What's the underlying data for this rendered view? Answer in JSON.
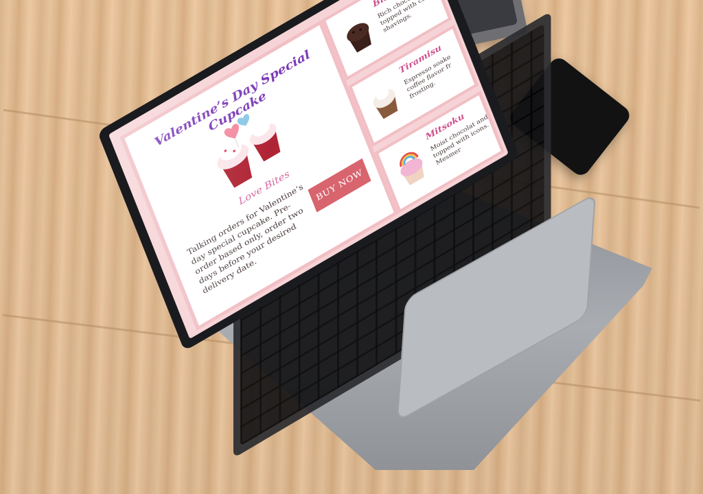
{
  "scene": {
    "objects": [
      "laptop",
      "smartphone",
      "tablet"
    ]
  },
  "screen": {
    "featured": {
      "title": "Valentine’s Day Special Cupcake",
      "subtitle": "Love Bites",
      "description": "Talking orders for Valentine’s day special cupcake. Pre-order based only, order two days before your desired delivery date.",
      "cta_label": "BUY NOW"
    },
    "side_items": [
      {
        "name": "Black Fo",
        "description": "Rich chocolate topped with ch shavings."
      },
      {
        "name": "Tiramisu",
        "description": "Espresso soake coffee flavor fr frosting."
      },
      {
        "name": "Mitsoku",
        "description": "Moist chocolat and topped with icons. Mesmer"
      }
    ]
  },
  "colors": {
    "screen_bg": "#f6d3d6",
    "card_border": "#f1bfc4",
    "title": "#7b3bb7",
    "accent": "#d66aa0",
    "button": "#d8646e"
  }
}
